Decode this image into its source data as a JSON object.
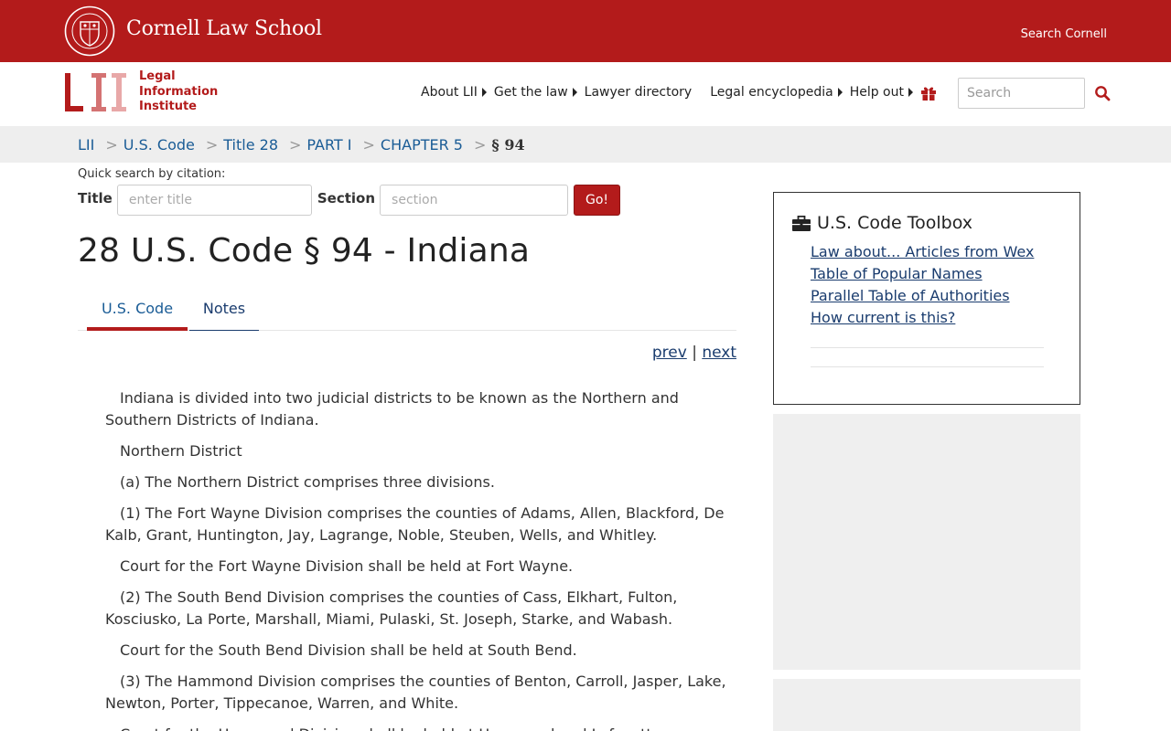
{
  "cornell": {
    "title": "Cornell Law School",
    "search_link": "Search Cornell"
  },
  "lii": {
    "logo_text": "LII",
    "name_line1": "Legal",
    "name_line2": "Information",
    "name_line3": "Institute"
  },
  "nav": {
    "items": [
      {
        "label": "About LII",
        "has_caret": true
      },
      {
        "label": "Get the law",
        "has_caret": true
      },
      {
        "label": "Lawyer directory",
        "has_caret": false
      },
      {
        "label": "Legal encyclopedia",
        "has_caret": true
      },
      {
        "label": "Help out",
        "has_caret": true
      }
    ],
    "gift_icon": "gift-icon",
    "search_placeholder": "Search",
    "search_icon": "search-icon"
  },
  "breadcrumb": {
    "items": [
      "LII",
      "U.S. Code",
      "Title 28",
      "PART I",
      "CHAPTER 5"
    ],
    "current": "§ 94",
    "separator": ">"
  },
  "quick_search": {
    "label": "Quick search by citation:",
    "title_label": "Title",
    "title_placeholder": "enter title",
    "section_label": "Section",
    "section_placeholder": "section",
    "go_label": "Go!"
  },
  "page_title": "28 U.S. Code § 94 - Indiana",
  "tabs": {
    "active": "U.S. Code",
    "notes": "Notes"
  },
  "pager": {
    "prev": "prev",
    "separator": "|",
    "next": "next"
  },
  "statute": {
    "paragraphs": [
      "Indiana is divided into two judicial districts to be known as the Northern and Southern Districts of Indiana.",
      "Northern District",
      "(a) The Northern District comprises three divisions.",
      "(1) The Fort Wayne Division comprises the counties of Adams, Allen, Blackford, De Kalb, Grant, Huntington, Jay, Lagrange, Noble, Steuben, Wells, and Whitley.",
      "Court for the Fort Wayne Division shall be held at Fort Wayne.",
      "(2) The South Bend Division comprises the counties of Cass, Elkhart, Fulton, Kosciusko, La Porte, Marshall, Miami, Pulaski, St. Joseph, Starke, and Wabash.",
      "Court for the South Bend Division shall be held at South Bend.",
      "(3) The Hammond Division comprises the counties of Benton, Carroll, Jasper, Lake, Newton, Porter, Tippecanoe, Warren, and White.",
      "Court for the Hammond Division shall be held at Hammond and Lafayette."
    ]
  },
  "toolbox": {
    "heading": "U.S. Code Toolbox",
    "icon": "briefcase-icon",
    "links": [
      "Law about... Articles from Wex",
      "Table of Popular Names",
      "Parallel Table of Authorities",
      "How current is this?"
    ]
  },
  "colors": {
    "brand_red": "#b31b1b",
    "link_blue": "#1a5c96",
    "breadcrumb_bg": "#eeeeee"
  }
}
